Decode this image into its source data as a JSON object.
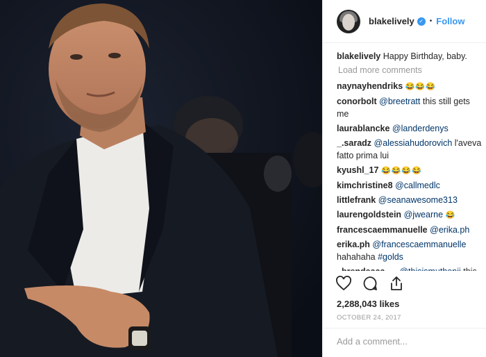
{
  "post": {
    "username": "blakelively",
    "follow_label": "Follow",
    "separator": "•",
    "caption_user": "blakelively",
    "caption_text": "Happy Birthday, baby.",
    "load_more": "Load more comments",
    "likes": "2,288,043 likes",
    "date": "October 24, 2017",
    "add_comment_placeholder": "Add a comment..."
  },
  "comments": [
    {
      "user": "naynayhendriks",
      "text": "",
      "mention": "",
      "emoji": "😂😂😂"
    },
    {
      "user": "conorbolt",
      "mention": "@breetratt",
      "text": " this still gets me",
      "emoji": ""
    },
    {
      "user": "laurablancke",
      "mention": "@landerdenys",
      "text": "",
      "emoji": ""
    },
    {
      "user": "_.saradz",
      "mention": "@alessiahudorovich",
      "text": " l'aveva fatto prima lui",
      "emoji": ""
    },
    {
      "user": "kyushl_17",
      "text": "",
      "mention": "",
      "emoji": "😂😂😂😂"
    },
    {
      "user": "kimchristine8",
      "mention": "@callmedlc",
      "text": "",
      "emoji": ""
    },
    {
      "user": "littlefrank",
      "mention": "@seanawesome313",
      "text": "",
      "emoji": ""
    },
    {
      "user": "laurengoldstein",
      "mention": "@jwearne",
      "text": " ",
      "emoji": "😂"
    },
    {
      "user": "francescaemmanuelle",
      "mention": "@erika.ph",
      "text": "",
      "emoji": ""
    },
    {
      "user": "erika.ph",
      "mention": "@francescaemmanuelle",
      "text": " hahahaha ",
      "emoji": "",
      "tag": "#golds"
    },
    {
      "user": "_brendaaaa.__",
      "mention": "@thisismuthonii",
      "text": " this couple is the best",
      "emoji": "😂😂"
    }
  ],
  "icons": [
    "heart-icon",
    "comment-icon",
    "share-icon"
  ],
  "colors": {
    "link": "#3897f0",
    "mention": "#003569",
    "muted": "#999999"
  }
}
